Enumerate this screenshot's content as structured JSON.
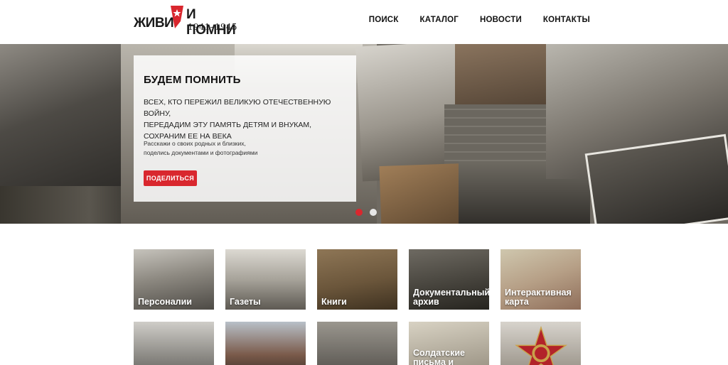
{
  "header": {
    "logo": {
      "part1": "ЖИВИ",
      "part2": "И ПОМНИ",
      "years": "1941–1945"
    },
    "nav": [
      {
        "label": "ПОИСК"
      },
      {
        "label": "КАТАЛОГ"
      },
      {
        "label": "НОВОСТИ"
      },
      {
        "label": "КОНТАКТЫ"
      }
    ]
  },
  "hero": {
    "title": "БУДЕМ ПОМНИТЬ",
    "text_lines": [
      "ВСЕХ, КТО ПЕРЕЖИЛ ВЕЛИКУЮ ОТЕЧЕСТВЕННУЮ ВОЙНУ,",
      "ПЕРЕДАДИМ ЭТУ ПАМЯТЬ ДЕТЯМ И ВНУКАМ,",
      "СОХРАНИМ ЕЕ НА ВЕКА"
    ],
    "note_lines": [
      "Расскажи о своих родных и близких,",
      "поделись документами и фотографиями"
    ],
    "button": "ПОДЕЛИТЬСЯ",
    "active_slide": 1,
    "slide_count": 2
  },
  "colors": {
    "accent": "#d9272e",
    "text": "#1e1e1e"
  },
  "categories": [
    {
      "label": "Персоналии"
    },
    {
      "label": "Газеты"
    },
    {
      "label": "Книги"
    },
    {
      "label": "Документальный архив"
    },
    {
      "label": "Интерактивная карта"
    },
    {
      "label": ""
    },
    {
      "label": ""
    },
    {
      "label": ""
    },
    {
      "label": "Солдатские письма и"
    },
    {
      "label": ""
    }
  ]
}
